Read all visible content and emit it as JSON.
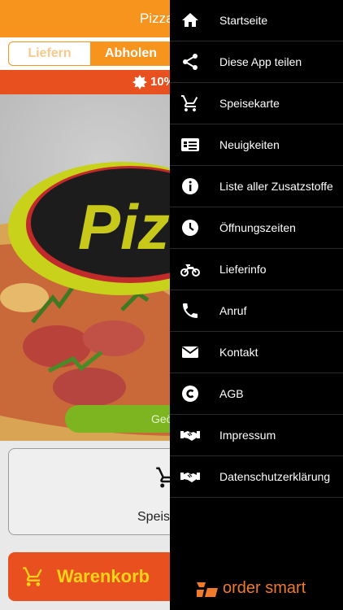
{
  "app": {
    "title": "Pizza",
    "tabs": {
      "deliver": "Liefern",
      "pickup": "Abholen"
    },
    "promo": "10%",
    "hero_logo_text": "Piz",
    "open_button": "Geö",
    "menu_card_label": "Speis",
    "cart_button": "Warenkorb"
  },
  "drawer": {
    "items": [
      {
        "label": "Startseite",
        "icon": "home-icon"
      },
      {
        "label": "Diese App teilen",
        "icon": "share-icon"
      },
      {
        "label": "Speisekarte",
        "icon": "cart-icon"
      },
      {
        "label": "Neuigkeiten",
        "icon": "news-icon"
      },
      {
        "label": "Liste aller Zusatzstoffe",
        "icon": "info-icon"
      },
      {
        "label": "Öffnungszeiten",
        "icon": "clock-icon"
      },
      {
        "label": "Lieferinfo",
        "icon": "motorcycle-icon"
      },
      {
        "label": "Anruf",
        "icon": "phone-icon"
      },
      {
        "label": "Kontakt",
        "icon": "mail-icon"
      },
      {
        "label": "AGB",
        "icon": "copyright-icon"
      },
      {
        "label": "Impressum",
        "icon": "handshake-icon"
      },
      {
        "label": "Datenschutzerklärung",
        "icon": "handshake-icon"
      }
    ],
    "brand": "order smart"
  },
  "colors": {
    "primary": "#f7941d",
    "promo": "#e8501f",
    "open_green": "#7cb51f",
    "cart_text": "#ffd21a",
    "drawer_bg": "#000000",
    "brand": "#f07a2b"
  }
}
